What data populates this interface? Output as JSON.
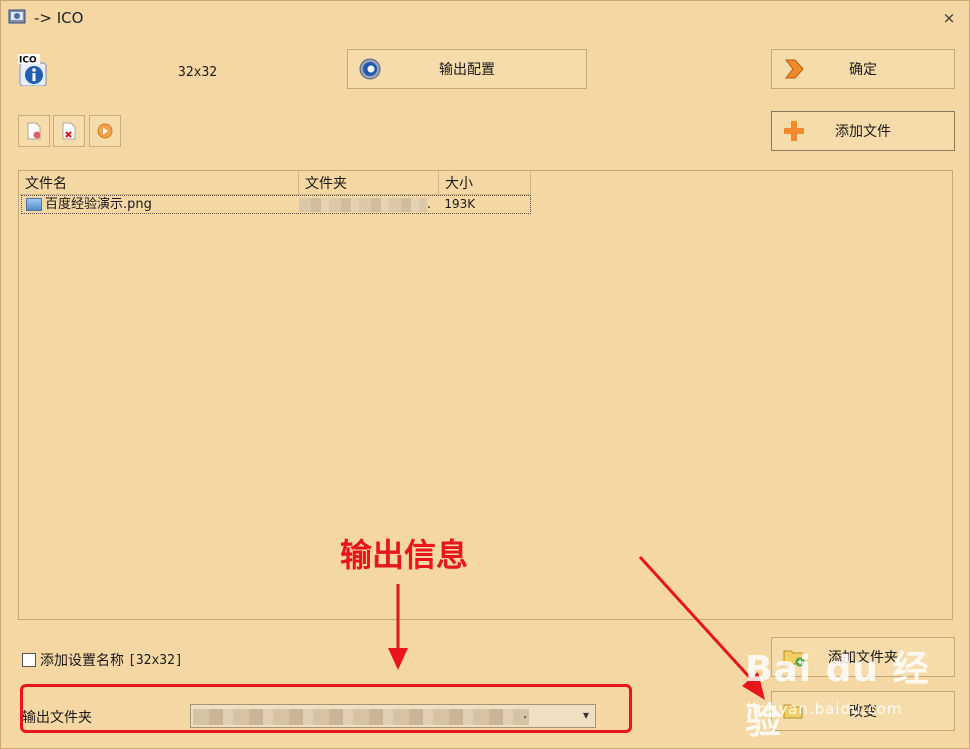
{
  "window": {
    "title": "-> ICO",
    "close_glyph": "×"
  },
  "format": {
    "icon": "ico-info-icon",
    "icon_text": "ICO",
    "size": "32x32"
  },
  "buttons": {
    "output_config": "输出配置",
    "confirm": "确定",
    "add_file": "添加文件",
    "add_folder": "添加文件夹",
    "change": "改变"
  },
  "file_list": {
    "columns": [
      "文件名",
      "文件夹",
      "大小"
    ],
    "rows": [
      {
        "name": "百度经验演示.png",
        "folder_suffix": ".",
        "size": "193K"
      }
    ]
  },
  "options": {
    "add_setting_name_label": "添加设置名称",
    "setting_name": "[32x32]",
    "checked": false
  },
  "output": {
    "label": "输出文件夹",
    "value_suffix": "."
  },
  "annotation": {
    "text": "输出信息",
    "color": "#e8151b"
  },
  "watermark": {
    "logo": "Bai du 经验",
    "url": "jingyan.baidu.com"
  },
  "colors": {
    "background": "#f4d7a3",
    "button": "#f6dcaa",
    "border": "#c4a877"
  }
}
